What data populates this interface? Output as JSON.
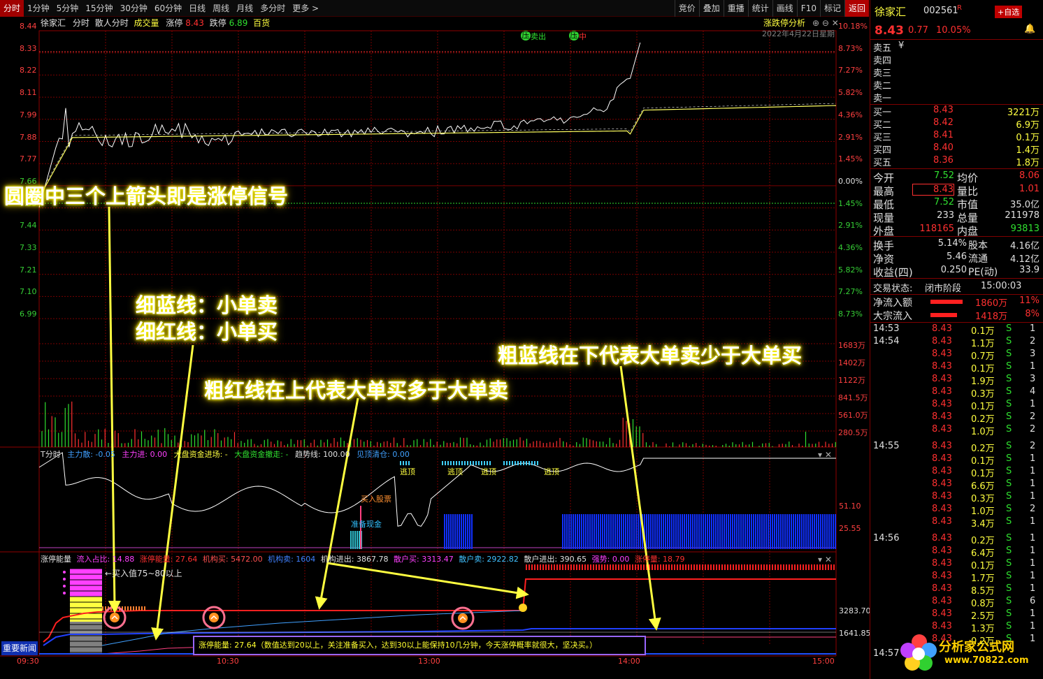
{
  "toolbar": {
    "items": [
      "分时",
      "1分钟",
      "5分钟",
      "15分钟",
      "30分钟",
      "60分钟",
      "日线",
      "周线",
      "月线",
      "多分时",
      "更多 >"
    ],
    "right": [
      "竞价",
      "叠加",
      "重播",
      "统计",
      "画线",
      "F10",
      "标记",
      "返回"
    ]
  },
  "main_header": {
    "name": "徐家汇",
    "mode": "分时",
    "sub": "散人分时",
    "vol": "成交量",
    "zt_label": "涨停",
    "zt_val": "8.43",
    "dt_label": "跌停",
    "dt_val": "6.89",
    "brand": "百货",
    "date": "2022年4月22日星期",
    "analysis": "涨跌停分析"
  },
  "price_axis": {
    "left": [
      "8.44",
      "8.33",
      "8.22",
      "8.11",
      "7.99",
      "7.88",
      "7.77",
      "7.66",
      "7.55",
      "7.44",
      "7.33",
      "7.21",
      "7.10",
      "6.99"
    ],
    "right": [
      "10.18%",
      "8.73%",
      "7.27%",
      "5.82%",
      "4.36%",
      "2.91%",
      "1.45%",
      "0.00%",
      "1.45%",
      "2.91%",
      "4.36%",
      "5.82%",
      "7.27%",
      "8.73%"
    ]
  },
  "vol_axis": [
    "1683万",
    "1402万",
    "1122万",
    "841.5万",
    "561.0万",
    "280.5万"
  ],
  "markers": {
    "sell_out": "卖出",
    "ya1": "压",
    "ya2": "压",
    "zhong": "中"
  },
  "t_panel": {
    "title": "T分时",
    "main_out": "主力散: -0.05",
    "main_in": "主力进: 0.00",
    "big_in": "大盘资金进场: -",
    "big_out": "大盘资金撤走: -",
    "trend": "趋势线: 100.00",
    "clear": "见顶清仓: 0.00",
    "escape_labels": [
      "逃顶",
      "逃顶",
      "逃顶",
      "逃顶"
    ],
    "buy_label": "买入股票",
    "prepare_label": "准备现金",
    "axis": [
      "51.10",
      "25.55"
    ]
  },
  "zt_panel": {
    "title": "涨停能量",
    "inflow": "流入占比: 14.88",
    "energy": "涨停能量: 27.64",
    "inst_buy": "机构买: 5472.00",
    "inst_sell": "机构卖: 1604",
    "inst_net": "机构进出: 3867.78",
    "retail_buy": "散户买: 3313.47",
    "retail_sell": "散户卖: 2922.82",
    "retail_net": "散户进出: 390.65",
    "strength": "强势: 0.00",
    "zt_qty": "涨停量: 18.79",
    "buy_hint": "←买入值75~80以上",
    "axis": [
      "3283.70",
      "1641.85"
    ],
    "info": "涨停能量: 27.64（数值达到20以上，关注准备买入，达到30以上能保持10几分钟，今天涨停概率就很大，坚决买。）"
  },
  "news_btn": "重要新闻",
  "time_axis": [
    "09:30",
    "10:30",
    "13:00",
    "14:00",
    "15:00"
  ],
  "annotations": {
    "a1": "圆圈中三个上箭头即是涨停信号",
    "a2": "细蓝线：小单卖",
    "a3": "细红线：小单买",
    "a4": "粗红线在上代表大单买多于大单卖",
    "a5": "粗蓝线在下代表大单卖少于大单买"
  },
  "quote": {
    "name": "徐家汇",
    "code": "002561",
    "flag": "R",
    "add_btn": "+自选",
    "price": "8.43",
    "change": "0.77",
    "pct": "10.05%",
    "sell": [
      {
        "l": "卖五",
        "p": "¥",
        "v": ""
      },
      {
        "l": "卖四",
        "p": "",
        "v": ""
      },
      {
        "l": "卖三",
        "p": "",
        "v": ""
      },
      {
        "l": "卖二",
        "p": "",
        "v": ""
      },
      {
        "l": "卖一",
        "p": "",
        "v": ""
      }
    ],
    "buy": [
      {
        "l": "买一",
        "p": "8.43",
        "v": "3221万"
      },
      {
        "l": "买二",
        "p": "8.42",
        "v": "6.9万"
      },
      {
        "l": "买三",
        "p": "8.41",
        "v": "0.1万"
      },
      {
        "l": "买四",
        "p": "8.40",
        "v": "1.4万"
      },
      {
        "l": "买五",
        "p": "8.36",
        "v": "1.8万"
      }
    ],
    "stats": [
      {
        "a": "今开",
        "av": "7.52",
        "b": "均价",
        "bv": "8.06"
      },
      {
        "a": "最高",
        "av": "8.43",
        "b": "量比",
        "bv": "1.01"
      },
      {
        "a": "最低",
        "av": "7.52",
        "b": "市值",
        "bv": "35.0亿"
      },
      {
        "a": "现量",
        "av": "233",
        "b": "总量",
        "bv": "211978"
      },
      {
        "a": "外盘",
        "av": "118165",
        "b": "内盘",
        "bv": "93813"
      }
    ],
    "stats2": [
      {
        "a": "换手",
        "av": "5.14%",
        "b": "股本",
        "bv": "4.16亿"
      },
      {
        "a": "净资",
        "av": "5.46",
        "b": "流通",
        "bv": "4.12亿"
      },
      {
        "a": "收益(四)",
        "av": "0.250",
        "b": "PE(动)",
        "bv": "33.9"
      }
    ],
    "status_label": "交易状态:",
    "status_val": "闭市阶段",
    "status_time": "15:00:03",
    "flow": [
      {
        "l": "净流入额",
        "v": "1860万",
        "p": "11%"
      },
      {
        "l": "大宗流入",
        "v": "1418万",
        "p": "8%"
      }
    ],
    "ticks": [
      {
        "t": "14:53",
        "p": "8.43",
        "v": "0.1万",
        "s": "S",
        "n": "1"
      },
      {
        "t": "14:54",
        "p": "8.43",
        "v": "1.1万",
        "s": "S",
        "n": "2"
      },
      {
        "t": "",
        "p": "8.43",
        "v": "0.7万",
        "s": "S",
        "n": "3"
      },
      {
        "t": "",
        "p": "8.43",
        "v": "0.1万",
        "s": "S",
        "n": "1"
      },
      {
        "t": "",
        "p": "8.43",
        "v": "1.9万",
        "s": "S",
        "n": "3"
      },
      {
        "t": "",
        "p": "8.43",
        "v": "0.3万",
        "s": "S",
        "n": "4"
      },
      {
        "t": "",
        "p": "8.43",
        "v": "0.1万",
        "s": "S",
        "n": "1"
      },
      {
        "t": "",
        "p": "8.43",
        "v": "0.2万",
        "s": "S",
        "n": "2"
      },
      {
        "t": "",
        "p": "8.43",
        "v": "1.0万",
        "s": "S",
        "n": "2"
      },
      {
        "t": "14:55",
        "p": "8.43",
        "v": "0.2万",
        "s": "S",
        "n": "2"
      },
      {
        "t": "",
        "p": "8.43",
        "v": "0.1万",
        "s": "S",
        "n": "1"
      },
      {
        "t": "",
        "p": "8.43",
        "v": "0.1万",
        "s": "S",
        "n": "1"
      },
      {
        "t": "",
        "p": "8.43",
        "v": "6.6万",
        "s": "S",
        "n": "1"
      },
      {
        "t": "",
        "p": "8.43",
        "v": "0.3万",
        "s": "S",
        "n": "1"
      },
      {
        "t": "",
        "p": "8.43",
        "v": "1.0万",
        "s": "S",
        "n": "2"
      },
      {
        "t": "",
        "p": "8.43",
        "v": "3.4万",
        "s": "S",
        "n": "1"
      },
      {
        "t": "14:56",
        "p": "8.43",
        "v": "0.2万",
        "s": "S",
        "n": "1"
      },
      {
        "t": "",
        "p": "8.43",
        "v": "6.4万",
        "s": "S",
        "n": "1"
      },
      {
        "t": "",
        "p": "8.43",
        "v": "0.1万",
        "s": "S",
        "n": "1"
      },
      {
        "t": "",
        "p": "8.43",
        "v": "1.7万",
        "s": "S",
        "n": "1"
      },
      {
        "t": "",
        "p": "8.43",
        "v": "8.5万",
        "s": "S",
        "n": "1"
      },
      {
        "t": "",
        "p": "8.43",
        "v": "0.8万",
        "s": "S",
        "n": "6"
      },
      {
        "t": "",
        "p": "8.43",
        "v": "2.5万",
        "s": "S",
        "n": "1"
      },
      {
        "t": "",
        "p": "8.43",
        "v": "1.3万",
        "s": "S",
        "n": "1"
      },
      {
        "t": "",
        "p": "8.43",
        "v": "0.2万",
        "s": "S",
        "n": "1"
      },
      {
        "t": "14:57",
        "p": "",
        "v": "",
        "s": "",
        "n": ""
      }
    ]
  },
  "logo": {
    "name": "分析家公式网",
    "url": "www.70822.com"
  },
  "colors": {
    "up": "#ff3030",
    "down": "#30e030",
    "price_line": "#ffffff",
    "avg_line": "#ffff60",
    "grid": "#7a0000"
  }
}
